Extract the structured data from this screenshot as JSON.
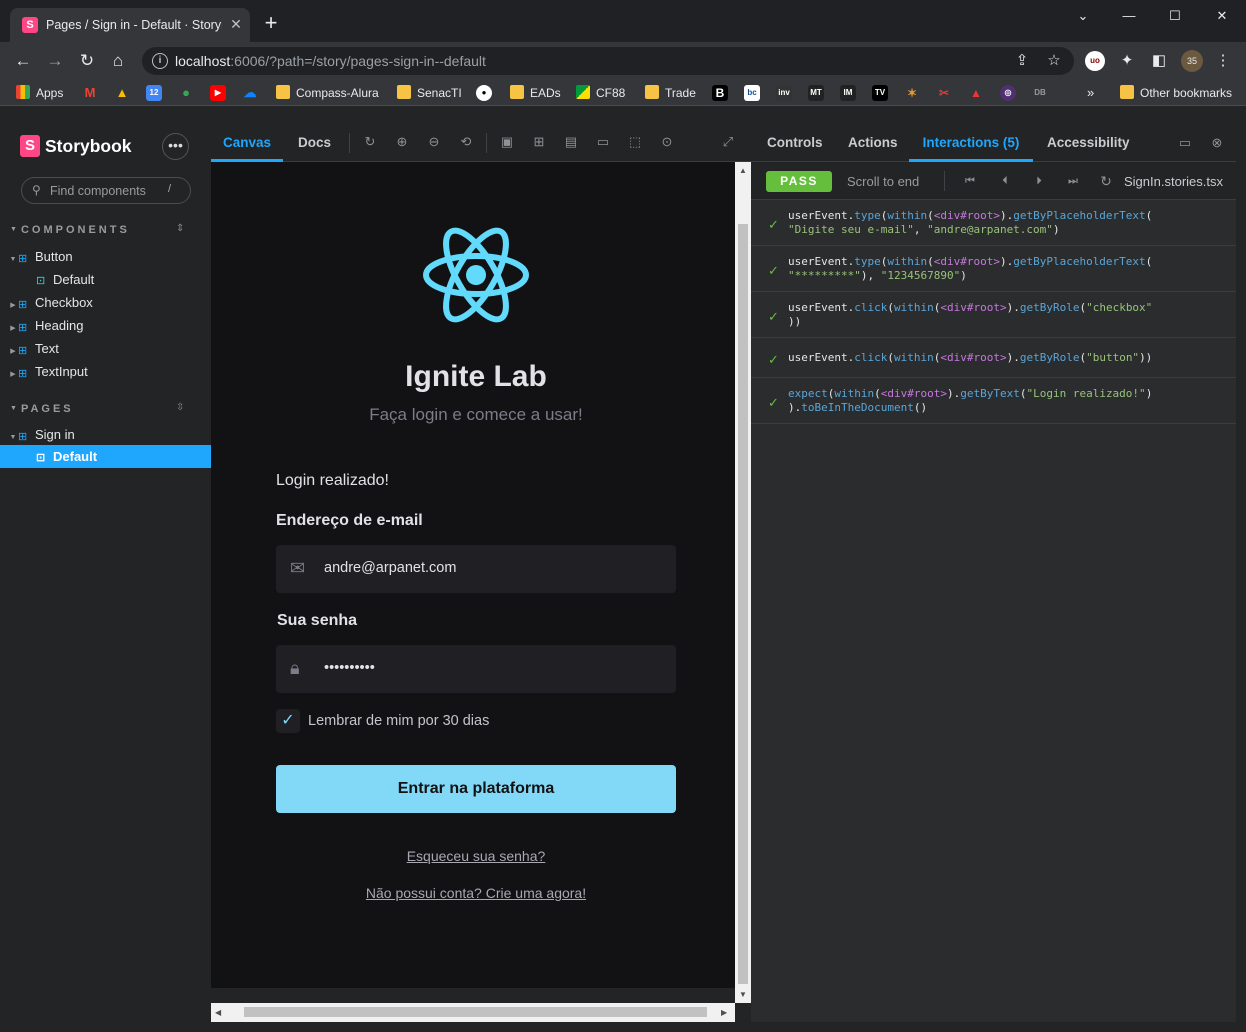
{
  "browser": {
    "tab_title": "Pages / Sign in - Default · Storybook",
    "tab_icon": "S",
    "url_host": "localhost",
    "url_rest": ":6006/?path=/story/pages-sign-in--default",
    "bookmarks": [
      "Apps",
      "Compass-Alura",
      "SenacTI",
      "EADs",
      "CF88",
      "Trade",
      "Other bookmarks"
    ],
    "profile_badge": "35"
  },
  "sidebar": {
    "logo_letter": "S",
    "brand": "Storybook",
    "menu_label": "•••",
    "search_placeholder": "Find components",
    "search_shortcut": "/",
    "components_header": "COMPONENTS",
    "pages_header": "PAGES",
    "components": [
      "Button",
      "Default",
      "Checkbox",
      "Heading",
      "Text",
      "TextInput"
    ],
    "pages": [
      "Sign in",
      "Default"
    ]
  },
  "preview": {
    "tabs": [
      "Canvas",
      "Docs"
    ],
    "app_title": "Ignite Lab",
    "app_subtitle": "Faça login e comece a usar!",
    "status_message": "Login realizado!",
    "email_label": "Endereço de e-mail",
    "email_value": "andre@arpanet.com",
    "password_label": "Sua senha",
    "password_value": "••••••••••",
    "remember_label": "Lembrar de mim por 30 dias",
    "remember_checked": true,
    "submit_label": "Entrar na plataforma",
    "forgot_link": "Esqueceu sua senha?",
    "signup_link": "Não possui conta? Crie uma agora!"
  },
  "addons": {
    "tabs": [
      "Controls",
      "Actions",
      "Interactions (5)",
      "Accessibility"
    ],
    "status": "PASS",
    "scroll_to_end": "Scroll to end",
    "story_file": "SignIn.stories.tsx",
    "interactions": [
      {
        "l1": [
          "userEvent",
          ".",
          "type",
          "(",
          "within",
          "(",
          "<div#root>",
          ").",
          "getByPlaceholderText",
          "("
        ],
        "l2": [
          "\"Digite seu e-mail\"",
          ", ",
          "\"andre@arpanet.com\"",
          ")"
        ]
      },
      {
        "l1": [
          "userEvent",
          ".",
          "type",
          "(",
          "within",
          "(",
          "<div#root>",
          ").",
          "getByPlaceholderText",
          "("
        ],
        "l2": [
          "\"*********\"",
          "), ",
          "\"1234567890\"",
          ")"
        ]
      },
      {
        "l1": [
          "userEvent",
          ".",
          "click",
          "(",
          "within",
          "(",
          "<div#root>",
          ").",
          "getByRole",
          "(",
          "\"checkbox\""
        ],
        "l2": [
          "))",
          "",
          "",
          ""
        ]
      },
      {
        "l1": [
          "userEvent",
          ".",
          "click",
          "(",
          "within",
          "(",
          "<div#root>",
          ").",
          "getByRole",
          "(",
          "\"button\"",
          "))"
        ],
        "l2": []
      },
      {
        "l1": [
          "expect",
          "(",
          "within",
          "(",
          "<div#root>",
          ").",
          "getByText",
          "(",
          "\"Login realizado!\"",
          ")"
        ],
        "l2": [
          ").",
          "toBeInTheDocument",
          "()"
        ]
      }
    ]
  },
  "colors": {
    "accent": "#1ea7fd",
    "storybook_pink": "#ff4785",
    "pass_green": "#66bf3c",
    "ignite_cyan": "#81d8f7",
    "react_blue": "#61dafb"
  }
}
